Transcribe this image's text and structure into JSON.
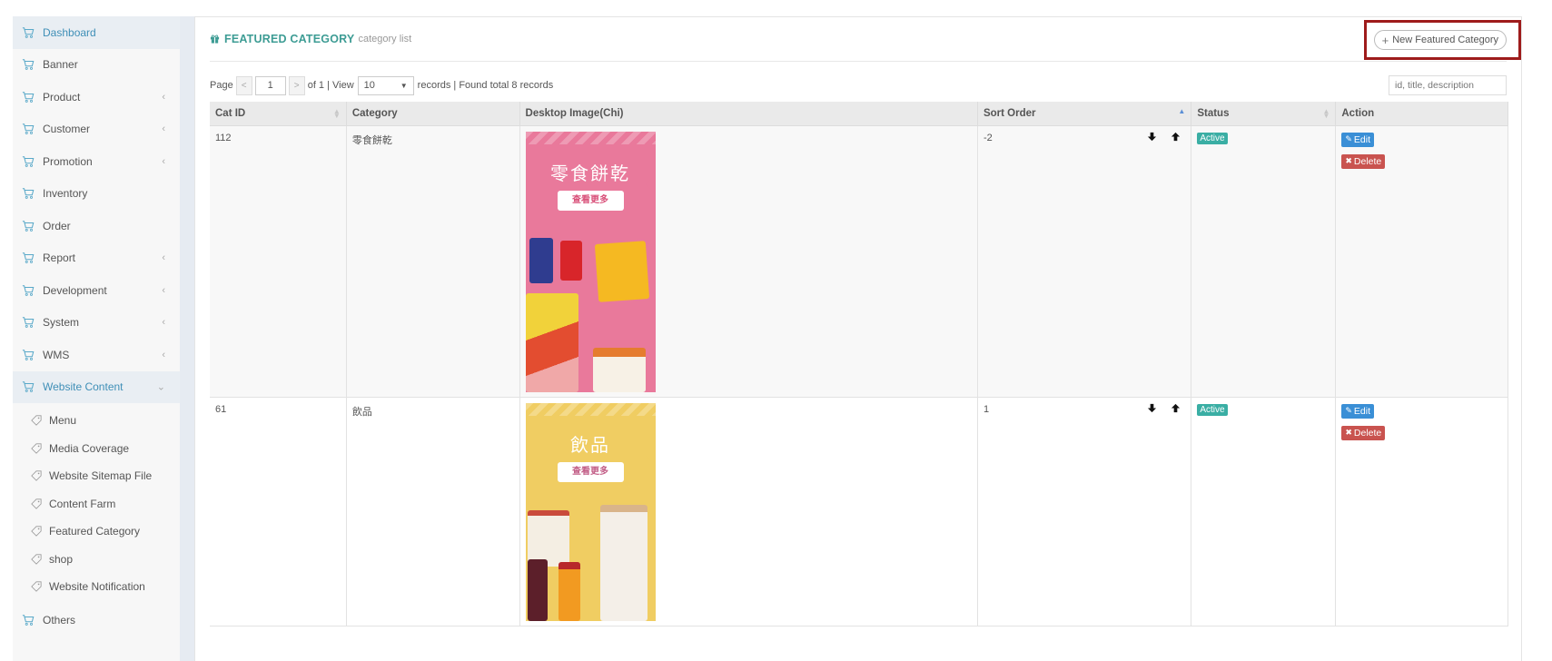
{
  "sidebar": {
    "items": [
      {
        "label": "Dashboard",
        "chevron": false
      },
      {
        "label": "Banner",
        "chevron": false
      },
      {
        "label": "Product",
        "chevron": true
      },
      {
        "label": "Customer",
        "chevron": true
      },
      {
        "label": "Promotion",
        "chevron": true
      },
      {
        "label": "Inventory",
        "chevron": false
      },
      {
        "label": "Order",
        "chevron": false
      },
      {
        "label": "Report",
        "chevron": true
      },
      {
        "label": "Development",
        "chevron": true
      },
      {
        "label": "System",
        "chevron": true
      },
      {
        "label": "WMS",
        "chevron": true
      },
      {
        "label": "Website Content",
        "chevron": true
      }
    ],
    "sub_items": [
      "Menu",
      "Media Coverage",
      "Website Sitemap File",
      "Content Farm",
      "Featured Category",
      "shop",
      "Website Notification"
    ],
    "others_label": "Others"
  },
  "header": {
    "title": "FEATURED CATEGORY",
    "subtitle": "category list",
    "new_button": "New Featured Category"
  },
  "pager": {
    "page_label": "Page",
    "page_value": "1",
    "of_text": "of 1 | View",
    "view_value": "10",
    "records_text": "records | Found total 8 records",
    "search_placeholder": "id, title, description"
  },
  "table": {
    "columns": [
      "Cat ID",
      "Category",
      "Desktop Image(Chi)",
      "Sort Order",
      "Status",
      "Action"
    ],
    "rows": [
      {
        "cat_id": "112",
        "category": "零食餅乾",
        "image_title": "零食餅乾",
        "image_button": "查看更多",
        "sort_order": "-2",
        "status": "Active",
        "edit": "Edit",
        "delete": "Delete"
      },
      {
        "cat_id": "61",
        "category": "飲品",
        "image_title": "飲品",
        "image_button": "查看更多",
        "sort_order": "1",
        "status": "Active",
        "edit": "Edit",
        "delete": "Delete"
      }
    ]
  },
  "colors": {
    "accent": "#3d9c94",
    "link": "#3f8fb7",
    "active_badge": "#3aaea4",
    "edit": "#3a8fd6",
    "delete": "#c9534f",
    "highlight_box": "#9e1b1b",
    "banner_pink": "#e9799b",
    "banner_yellow": "#f0cd62"
  }
}
